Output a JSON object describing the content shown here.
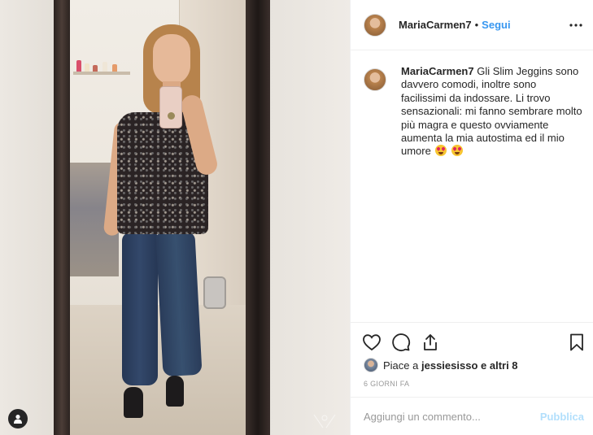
{
  "post_header": {
    "username": "MariaCarmen7",
    "separator": "•",
    "follow_label": "Segui",
    "more_icon": "more-horizontal-icon"
  },
  "caption": {
    "username": "MariaCarmen7",
    "text": "Gli Slim Jeggins sono davvero comodi, inoltre sono facilissimi da indossare. Li trovo sensazionali: mi fanno sembrare molto più magra e questo ovviamente aumenta la mia autostima ed il mio umore",
    "emojis": [
      "heart-eyes-emoji",
      "heart-eyes-emoji"
    ]
  },
  "actions": {
    "like_icon": "heart-icon",
    "comment_icon": "comment-icon",
    "share_icon": "share-icon",
    "save_icon": "bookmark-icon"
  },
  "likes": {
    "prefix": "Piace a",
    "user": "jessiesisso",
    "suffix": "e altri 8"
  },
  "timestamp": "6 GIORNI FA",
  "comment_box": {
    "placeholder": "Aggiungi un commento...",
    "publish_label": "Pubblica"
  },
  "photo": {
    "user_tag_icon": "user-tag-icon"
  },
  "colors": {
    "link_blue": "#3897f0",
    "publish_disabled": "#b2dffc",
    "text": "#262626",
    "muted": "#999999",
    "border": "#efefef"
  }
}
